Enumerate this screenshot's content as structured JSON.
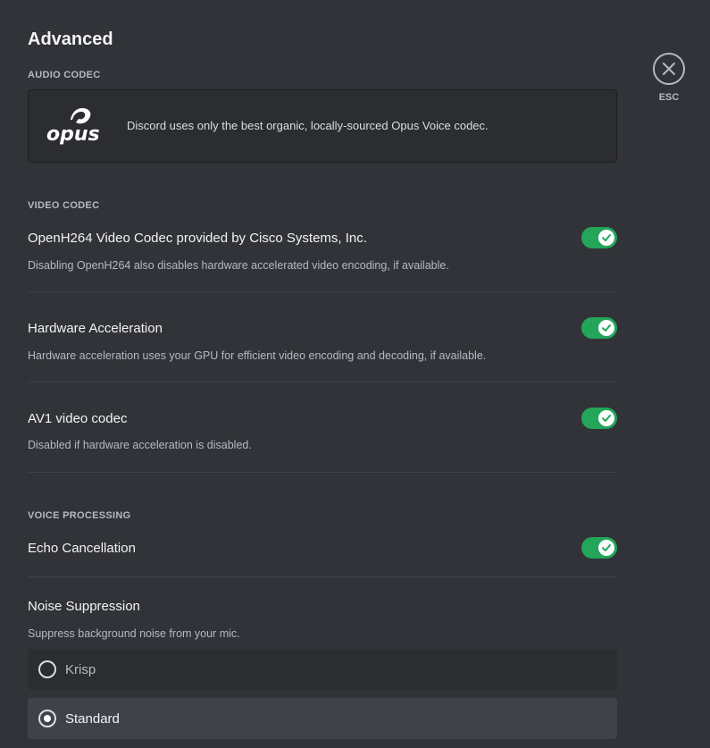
{
  "page": {
    "title": "Advanced",
    "esc_label": "ESC"
  },
  "audio_codec": {
    "label": "AUDIO CODEC",
    "description": "Discord uses only the best organic, locally-sourced Opus Voice codec.",
    "logo_text": "opus"
  },
  "video_codec": {
    "label": "VIDEO CODEC",
    "settings": [
      {
        "title": "OpenH264 Video Codec provided by Cisco Systems, Inc.",
        "description": "Disabling OpenH264 also disables hardware accelerated video encoding, if available.",
        "enabled": true
      },
      {
        "title": "Hardware Acceleration",
        "description": "Hardware acceleration uses your GPU for efficient video encoding and decoding, if available.",
        "enabled": true
      },
      {
        "title": "AV1 video codec",
        "description": "Disabled if hardware acceleration is disabled.",
        "enabled": true
      }
    ]
  },
  "voice_processing": {
    "label": "VOICE PROCESSING",
    "echo_cancellation": {
      "title": "Echo Cancellation",
      "enabled": true
    },
    "noise_suppression": {
      "title": "Noise Suppression",
      "description": "Suppress background noise from your mic.",
      "options": [
        {
          "label": "Krisp",
          "selected": false
        },
        {
          "label": "Standard",
          "selected": true
        }
      ]
    }
  },
  "colors": {
    "background": "#313338",
    "toggle_on": "#23a55a",
    "selected_row": "#404249",
    "row": "#2b2d31"
  },
  "icons": {
    "close": "close-icon",
    "check": "check-icon",
    "logo": "opus-logo"
  }
}
